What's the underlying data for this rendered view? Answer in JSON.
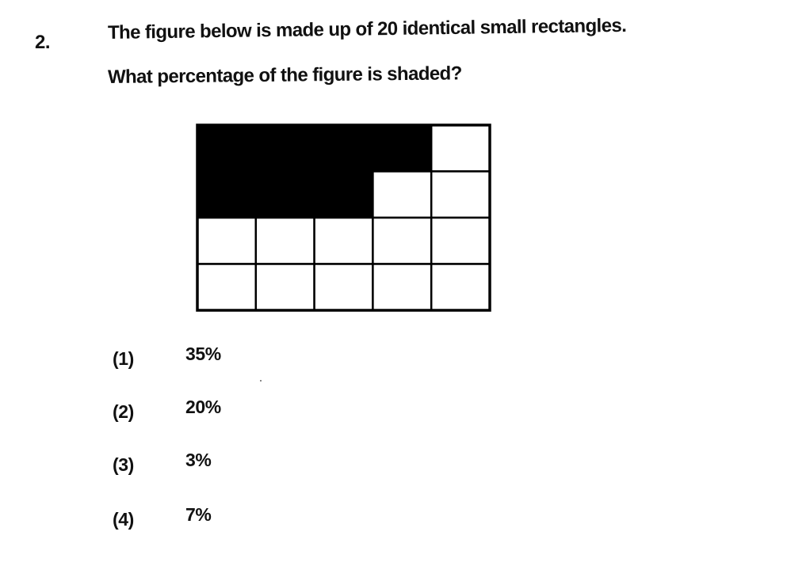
{
  "question": {
    "number": "2.",
    "line1": "The figure below is made up of 20 identical small rectangles.",
    "line2": "What percentage of the figure is shaded?"
  },
  "figure": {
    "rows": 4,
    "columns": 5,
    "shaded_cells": [
      [
        0,
        0
      ],
      [
        0,
        1
      ],
      [
        0,
        2
      ],
      [
        0,
        3
      ],
      [
        1,
        0
      ],
      [
        1,
        1
      ],
      [
        1,
        2
      ]
    ],
    "shade_color": "#000000",
    "line_color": "#000000"
  },
  "options": [
    {
      "label": "(1)",
      "value": "35%"
    },
    {
      "label": "(2)",
      "value": "20%"
    },
    {
      "label": "(3)",
      "value": "3%"
    },
    {
      "label": "(4)",
      "value": "7%"
    }
  ]
}
